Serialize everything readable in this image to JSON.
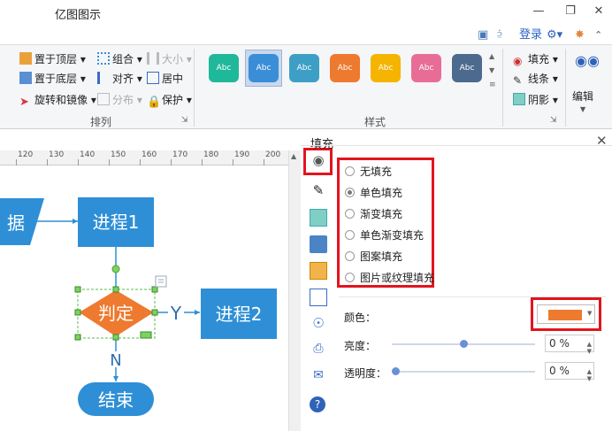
{
  "app": {
    "title": "亿图图示",
    "login_label": "登录",
    "window_buttons": [
      "minimize-icon",
      "restore-icon",
      "close-icon"
    ]
  },
  "ribbon": {
    "arrange": {
      "label": "排列",
      "bring_front": "置于顶层",
      "send_back": "置于底层",
      "rotate_mirror": "旋转和镜像",
      "group": "组合",
      "align": "对齐",
      "distribute": "分布",
      "size": "大小",
      "center": "居中",
      "protect": "保护"
    },
    "styles": {
      "label": "样式",
      "swatch_text": "Abc",
      "swatches": [
        "#1fb89a",
        "#3a8ed8",
        "#3e9fc6",
        "#ee7a2f",
        "#f5b400",
        "#e86d96",
        "#4b6a8e"
      ],
      "selected_index": 1
    },
    "fill_label": "填充",
    "line_label": "线条",
    "shadow_label": "阴影",
    "edit_label": "编辑"
  },
  "ruler": {
    "ticks": [
      "120",
      "130",
      "140",
      "150",
      "160",
      "170",
      "180",
      "190",
      "200"
    ]
  },
  "diagram": {
    "data_label": "据",
    "process1": "进程1",
    "decision": "判定",
    "yes_label": "Y",
    "process2": "进程2",
    "no_label": "N",
    "end": "结束"
  },
  "fill_panel": {
    "title": "填充",
    "options": [
      "无填充",
      "单色填充",
      "渐变填充",
      "单色渐变填充",
      "图案填充",
      "图片或纹理填充"
    ],
    "selected_option_index": 1,
    "color_label": "颜色：",
    "color_value": "#ee7a2f",
    "brightness_label": "亮度：",
    "brightness_value": "0 %",
    "brightness_level": 0.5,
    "transparency_label": "透明度：",
    "transparency_value": "0 %",
    "transparency_level": 0
  },
  "colors": {
    "accent_blue": "#2e8fd6",
    "decision_orange": "#ee7a2f",
    "highlight_red": "#e3141d"
  }
}
